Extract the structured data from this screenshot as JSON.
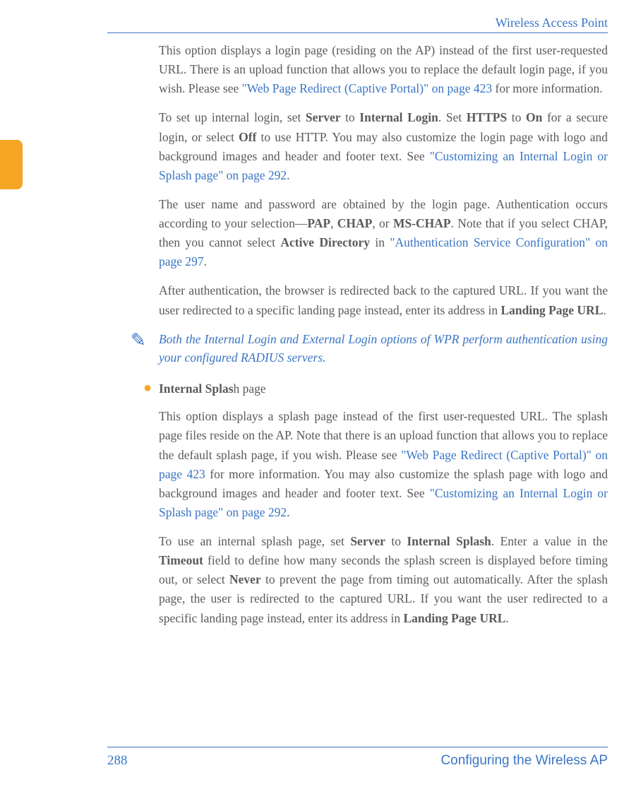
{
  "header": {
    "title": "Wireless Access Point"
  },
  "body": {
    "p1_a": "This option displays a login page (residing on the AP) instead of the first user-requested URL. There is an upload function that allows you to replace the default login page, if you wish. Please see ",
    "p1_link": "\"Web Page Redirect (Captive Portal)\" on page 423",
    "p1_b": " for more information.",
    "p2_a": "To set up internal login, set ",
    "p2_b1": "Server",
    "p2_c": " to ",
    "p2_b2": "Internal Login",
    "p2_d": ". Set ",
    "p2_b3": "HTTPS",
    "p2_e": " to ",
    "p2_b4": "On",
    "p2_f": " for a secure login, or select ",
    "p2_b5": "Off",
    "p2_g": " to use HTTP. You may also customize the login page with logo and background images and header and footer text. See ",
    "p2_link": "\"Customizing an Internal Login or Splash page\" on page 292",
    "p2_h": ".",
    "p3_a": "The user name and password are obtained by the login page. Authentication occurs according to your selection—",
    "p3_b1": "PAP",
    "p3_c": ", ",
    "p3_b2": "CHAP",
    "p3_d": ", or ",
    "p3_b3": "MS-CHAP",
    "p3_e": ". Note that if you select CHAP, then you cannot select ",
    "p3_b4": "Active Directory",
    "p3_f": " in ",
    "p3_link": "\"Authentication Service Configuration\" on page 297",
    "p3_g": ".",
    "p4_a": "After authentication, the browser is redirected back to the captured URL. If you want the user redirected to a specific landing page instead, enter its address in ",
    "p4_b1": "Landing Page URL",
    "p4_c": ".",
    "note": "Both the Internal Login and External Login options of WPR perform authentication using your configured RADIUS servers.",
    "bullet_b": "Internal Splas",
    "bullet_r": "h page",
    "p5_a": "This option displays a splash page instead of the first user-requested URL. The splash page files reside on the AP. Note that there is an upload function that allows you to replace the default splash page, if you wish. Please see ",
    "p5_link1": "\"Web Page Redirect (Captive Portal)\" on page 423",
    "p5_b": " for more information. You may also customize the splash page with logo and background images and header and footer text. See ",
    "p5_link2": "\"Customizing an Internal Login or Splash page\" on page 292",
    "p5_c": ".",
    "p6_a": "To use an internal splash page, set ",
    "p6_b1": "Server",
    "p6_c": " to ",
    "p6_b2": "Internal Splash",
    "p6_d": ". Enter a value in the ",
    "p6_b3": "Timeout",
    "p6_e": " field to define how many seconds the splash screen is displayed before timing out, or select ",
    "p6_b4": "Never",
    "p6_f": " to prevent the page from timing out automatically. After the splash page, the user is redirected to the captured URL. If you want the user redirected to a specific landing page instead, enter its address in ",
    "p6_b5": "Landing Page URL",
    "p6_g": "."
  },
  "footer": {
    "page": "288",
    "section": "Configuring the Wireless AP"
  }
}
